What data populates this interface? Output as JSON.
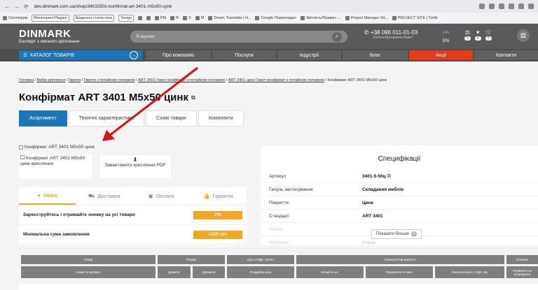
{
  "browser": {
    "url": "dev.dinmark.com.ua/shop/3401550c-konfirmat-art-3401-m5x50-cynk",
    "bookmarks": [
      "Сентигрум",
      "Моніторинг/Ладані",
      "Щоденна статистика",
      "Songs",
      "PM",
      "R",
      "S",
      "M",
      "Deepl, Translate | H...",
      "Google Перекладач",
      "Звітність/Правки -...",
      "Project Manager Sit...",
      "PROJECT SITE | Trello"
    ]
  },
  "header": {
    "brand": "DINMARK",
    "tagline": "Експерт з якісного кріплення",
    "search_placeholder": "Я шукаю",
    "phone": "+38 096 011-01-03",
    "phone_sub": "Зателефонувати Вам?",
    "lang_active": "UA",
    "lang_other": "EN",
    "counters": [
      "0",
      "0",
      "0"
    ]
  },
  "nav": {
    "catalog": "КАТАЛОГ ТОВАРІВ",
    "items": [
      "Про компанію",
      "Послуги",
      "Індустрії",
      "Блог",
      "Акції",
      "Контакти"
    ]
  },
  "breadcrumb": [
    "Головна",
    "Вибір кріплення",
    "Гвинти",
    "Гвинти з потайною головкою",
    "ART 3401 Гвинт конфірмат з потайною головкою",
    "ART 3401 цинк Гвинт конфірмат з потайною головкою",
    "Конфірмат ART 3401 M5x50 цинк"
  ],
  "product": {
    "title": "Конфірмат ART 3401 M5x50 цинк",
    "tabs": [
      "Асортимент",
      "Технічні характеристики",
      "Схожі товари",
      "Комплекти"
    ],
    "image_alt": "Конфірмат ART 3401 M5x50 цинк",
    "drawing_alt": "Конфірмат ART 3401 M5x50 цинк креслення",
    "pdf_label": "Завантажити креслення PDF"
  },
  "info": {
    "tabs": [
      "Увага",
      "Доставка",
      "Оплати",
      "Гарантія"
    ],
    "rows": [
      {
        "label": "Зареєструйтесь і отримайте знижку на усі товари",
        "value": "2%"
      },
      {
        "label": "Мінімальна сума замовлення",
        "value": "1200 грн"
      }
    ]
  },
  "specs": {
    "title": "Специфікації",
    "rows": [
      {
        "k": "Артикул",
        "v": "3401-5-50ц"
      },
      {
        "k": "Галузь застосування",
        "v": "Складання меблів"
      },
      {
        "k": "Покриття",
        "v": "Цинк"
      },
      {
        "k": "Стандарт",
        "v": "ART 3401"
      },
      {
        "k": "Різьба",
        "v": ""
      },
      {
        "k": "Матеріал",
        "v": "Сталь"
      }
    ],
    "show_more": "Показати більше"
  },
  "table": {
    "groups": [
      "Товар",
      "Розмір",
      "Ціна з ПДВ, грн/шт",
      "Калькулятор вартості",
      "Покупка"
    ],
    "cols": [
      "Назва та артикул",
      "Діаметр",
      "Довжина",
      "Роздрібна ціна",
      "Кількість шт",
      "Пакування та вага",
      "Загальна ціна з ПДВ, грн",
      "Порівняти не впорядкати"
    ]
  }
}
